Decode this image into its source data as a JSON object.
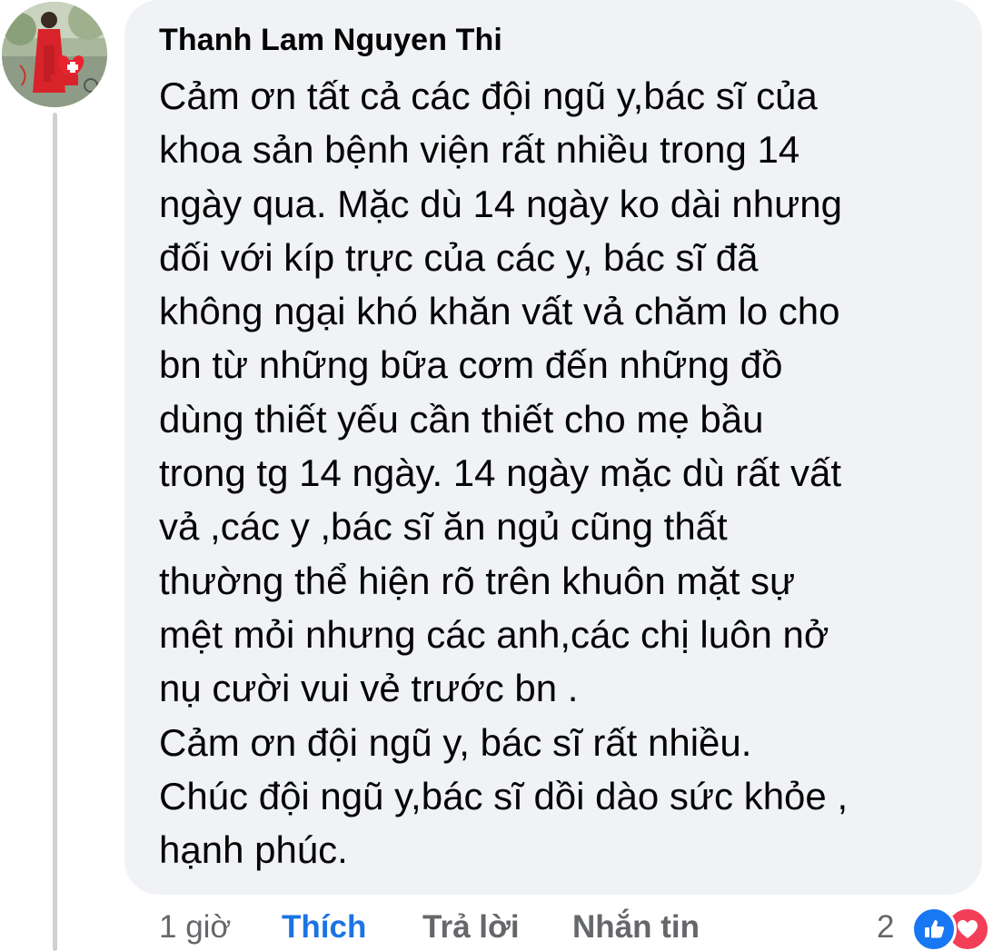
{
  "comment": {
    "author": "Thanh Lam Nguyen Thi",
    "lines": [
      "Cảm ơn tất cả các đội ngũ y,bác sĩ của",
      "khoa sản bệnh viện rất nhiều trong 14",
      "ngày qua. Mặc dù 14 ngày ko dài nhưng",
      "đối với kíp trực của các y, bác sĩ đã",
      "không ngại khó khăn vất vả chăm lo cho",
      "bn từ những bữa cơm đến những đồ",
      "dùng thiết yếu cần thiết cho mẹ bầu",
      "trong tg 14 ngày. 14 ngày mặc dù rất vất",
      "vả ,các y ,bác sĩ ăn ngủ cũng thất",
      "thường thể hiện rõ trên khuôn mặt sự",
      "mệt mỏi nhưng các anh,các chị luôn nở",
      "nụ cười vui vẻ trước bn .",
      "Cảm ơn đội ngũ y, bác sĩ rất nhiều.",
      "Chúc đội ngũ y,bác sĩ dồi dào sức khỏe ,",
      "hạnh phúc."
    ]
  },
  "actions": {
    "time": "1 giờ",
    "like": "Thích",
    "reply": "Trả lời",
    "message": "Nhắn tin"
  },
  "reactions": {
    "count": "2",
    "icons": [
      "like-icon",
      "love-icon"
    ]
  },
  "colors": {
    "bubble": "#f0f2f5",
    "like_active": "#1b74e4",
    "secondary_text": "#65676b",
    "like_reaction": "#1877f2",
    "love_reaction": "#f33e58"
  }
}
